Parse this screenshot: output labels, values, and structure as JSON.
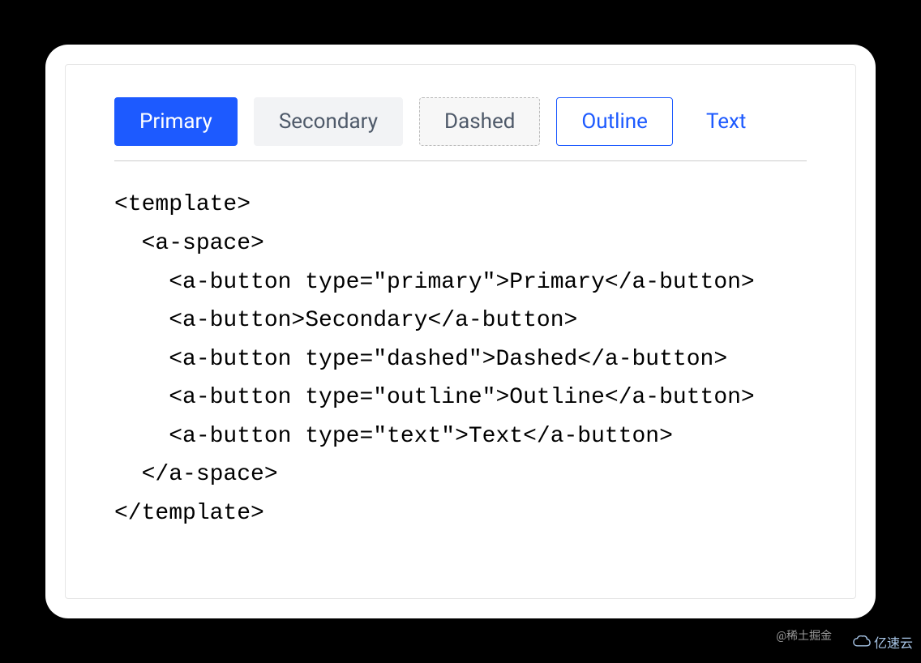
{
  "buttons": {
    "primary": "Primary",
    "secondary": "Secondary",
    "dashed": "Dashed",
    "outline": "Outline",
    "text": "Text"
  },
  "code": {
    "line1": "<template>",
    "line2": "  <a-space>",
    "line3": "    <a-button type=\"primary\">Primary</a-button>",
    "line4": "    <a-button>Secondary</a-button>",
    "line5": "    <a-button type=\"dashed\">Dashed</a-button>",
    "line6": "    <a-button type=\"outline\">Outline</a-button>",
    "line7": "    <a-button type=\"text\">Text</a-button>",
    "line8": "  </a-space>",
    "line9": "</template>"
  },
  "watermark1": "@稀土掘金",
  "watermark2": "亿速云"
}
